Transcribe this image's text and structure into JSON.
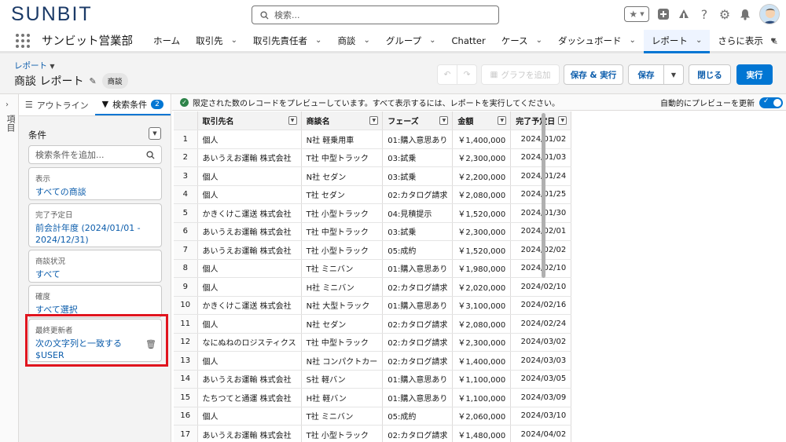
{
  "header": {
    "logo": "SUNBIT",
    "search_placeholder": "検索..."
  },
  "nav": {
    "app_name": "サンビット営業部",
    "items": [
      {
        "label": "ホーム",
        "chevron": false
      },
      {
        "label": "取引先",
        "chevron": true
      },
      {
        "label": "取引先責任者",
        "chevron": true
      },
      {
        "label": "商談",
        "chevron": true
      },
      {
        "label": "グループ",
        "chevron": true
      },
      {
        "label": "Chatter",
        "chevron": false
      },
      {
        "label": "ケース",
        "chevron": true
      },
      {
        "label": "ダッシュボード",
        "chevron": true
      },
      {
        "label": "レポート",
        "chevron": true,
        "active": true
      },
      {
        "label": "さらに表示",
        "chevron": true
      }
    ]
  },
  "report_header": {
    "breadcrumb": "レポート",
    "title": "商談 レポート",
    "type_badge": "商談",
    "add_chart": "グラフを追加",
    "save_run": "保存 & 実行",
    "save": "保存",
    "close": "閉じる",
    "run": "実行"
  },
  "rail": {
    "label": "項目"
  },
  "filter_panel": {
    "tab_outline": "アウトライン",
    "tab_filters": "検索条件",
    "filter_count": "2",
    "conditions_title": "条件",
    "add_filter_placeholder": "検索条件を追加...",
    "cards": [
      {
        "label": "表示",
        "value": "すべての商談"
      },
      {
        "label": "完了予定日",
        "value": "前会計年度 (2024/01/01 - 2024/12/31)"
      },
      {
        "label": "商談状況",
        "value": "すべて"
      },
      {
        "label": "確度",
        "value": "すべて選択"
      },
      {
        "label": "最終更新者",
        "value": "次の文字列と一致する",
        "value2": "$USER"
      }
    ]
  },
  "preview": {
    "info_text": "限定された数のレコードをプレビューしています。すべて表示するには、レポートを実行してください。",
    "auto_preview": "自動的にプレビューを更新",
    "columns": [
      "取引先名",
      "商談名",
      "フェーズ",
      "金額",
      "完了予定日"
    ],
    "rows": [
      [
        "1",
        "個人",
        "N社 軽乗用車",
        "01:購入意思あり",
        "￥1,400,000",
        "2024/01/02"
      ],
      [
        "2",
        "あいうえお運輸 株式会社",
        "T社 中型トラック",
        "03:試乗",
        "￥2,300,000",
        "2024/01/03"
      ],
      [
        "3",
        "個人",
        "N社 セダン",
        "03:試乗",
        "￥2,200,000",
        "2024/01/24"
      ],
      [
        "4",
        "個人",
        "T社 セダン",
        "02:カタログ請求",
        "￥2,080,000",
        "2024/01/25"
      ],
      [
        "5",
        "かきくけこ運送 株式会社",
        "T社 小型トラック",
        "04:見積提示",
        "￥1,520,000",
        "2024/01/30"
      ],
      [
        "6",
        "あいうえお運輸 株式会社",
        "T社 中型トラック",
        "03:試乗",
        "￥2,300,000",
        "2024/02/01"
      ],
      [
        "7",
        "あいうえお運輸 株式会社",
        "T社 小型トラック",
        "05:成約",
        "￥1,520,000",
        "2024/02/02"
      ],
      [
        "8",
        "個人",
        "T社 ミニバン",
        "01:購入意思あり",
        "￥1,980,000",
        "2024/02/10"
      ],
      [
        "9",
        "個人",
        "H社 ミニバン",
        "02:カタログ請求",
        "￥2,020,000",
        "2024/02/10"
      ],
      [
        "10",
        "かきくけこ運送 株式会社",
        "N社 大型トラック",
        "01:購入意思あり",
        "￥3,100,000",
        "2024/02/16"
      ],
      [
        "11",
        "個人",
        "N社 セダン",
        "02:カタログ請求",
        "￥2,080,000",
        "2024/02/24"
      ],
      [
        "12",
        "なにぬねのロジスティクス",
        "T社 中型トラック",
        "02:カタログ請求",
        "￥2,300,000",
        "2024/03/02"
      ],
      [
        "13",
        "個人",
        "N社 コンパクトカー",
        "02:カタログ請求",
        "￥1,400,000",
        "2024/03/03"
      ],
      [
        "14",
        "あいうえお運輸 株式会社",
        "S社 軽バン",
        "01:購入意思あり",
        "￥1,100,000",
        "2024/03/05"
      ],
      [
        "15",
        "たちつてと通運 株式会社",
        "H社 軽バン",
        "01:購入意思あり",
        "￥1,100,000",
        "2024/03/09"
      ],
      [
        "16",
        "個人",
        "T社 ミニバン",
        "05:成約",
        "￥2,060,000",
        "2024/03/10"
      ],
      [
        "17",
        "あいうえお運輸 株式会社",
        "T社 小型トラック",
        "02:カタログ請求",
        "￥1,480,000",
        "2024/04/02"
      ]
    ]
  },
  "colors": {
    "brand": "#1b3a67",
    "accent": "#0176d3",
    "highlight": "#e0141e"
  }
}
